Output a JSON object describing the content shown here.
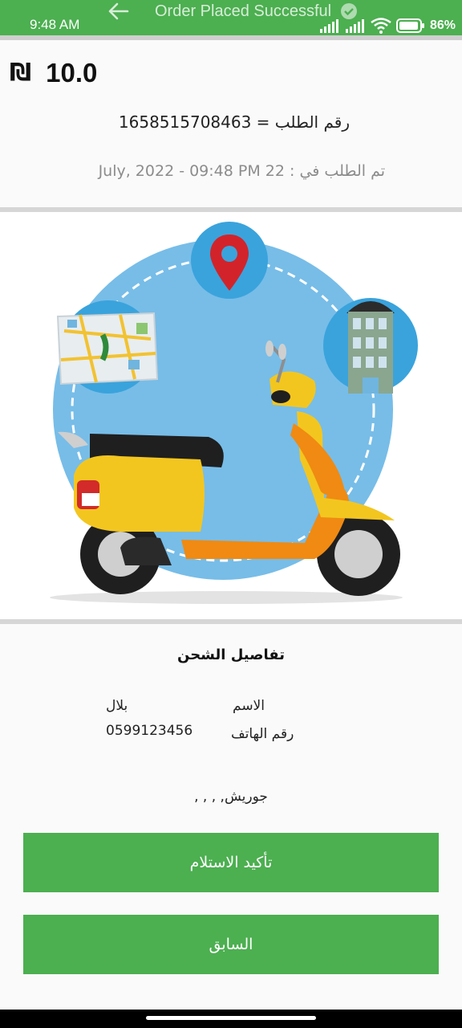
{
  "status_bar": {
    "time": "9:48 AM",
    "battery": "86%",
    "icons": [
      "signal-icon",
      "signal-icon",
      "wifi-icon",
      "battery-icon"
    ]
  },
  "header": {
    "title": "Order Placed Successful",
    "back_icon": "arrow-left-icon",
    "check_icon": "check-circle-icon"
  },
  "order": {
    "currency_symbol": "₪",
    "price": "10.0",
    "number_line": "رقم الطلب = 1658515708463",
    "date_line": "تم الطلب في  : 22 July, 2022 - 09:48 PM"
  },
  "shipping": {
    "title": "تفاصيل الشحن",
    "name_label": "الاسم",
    "name_value": "بلال",
    "phone_label": "رقم الهاتف",
    "phone_value": "0599123456",
    "address": "جوريش, , , ,"
  },
  "buttons": {
    "confirm": "تأكيد الاستلام",
    "previous": "السابق"
  },
  "colors": {
    "primary": "#4caf50",
    "background": "#fafafa",
    "circle_blue": "#77bde8"
  }
}
